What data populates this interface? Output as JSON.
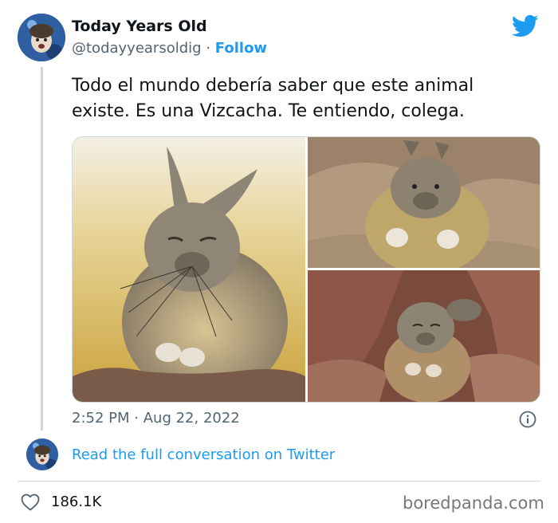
{
  "author": {
    "name": "Today Years Old",
    "handle": "@todayyearsoldig",
    "separator": "·",
    "follow_label": "Follow"
  },
  "tweet": {
    "text": "Todo el mundo debería saber que este animal existe. Es una Vizcacha. Te entiendo, colega.",
    "time": "2:52 PM",
    "time_separator": "·",
    "date": "Aug 22, 2022"
  },
  "conversation_link": "Read the full conversation on Twitter",
  "stats": {
    "likes": "186.1K"
  },
  "watermark": "boredpanda.com",
  "icons": {
    "twitter": "twitter-bird-icon",
    "info": "info-icon",
    "heart": "heart-icon"
  },
  "colors": {
    "accent": "#1d9bf0",
    "text": "#0f1419",
    "muted": "#536471",
    "border": "#cfd9de"
  }
}
